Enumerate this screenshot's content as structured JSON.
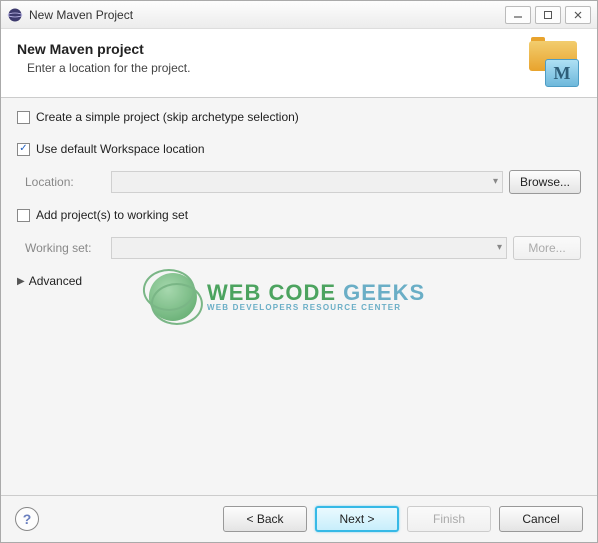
{
  "window": {
    "title": "New Maven Project"
  },
  "banner": {
    "heading": "New Maven project",
    "subtitle": "Enter a location for the project.",
    "icon_letter": "M"
  },
  "options": {
    "simple_project": {
      "checked": false,
      "label": "Create a simple project (skip archetype selection)"
    },
    "default_workspace": {
      "checked": true,
      "label": "Use default Workspace location"
    },
    "location": {
      "label": "Location:",
      "value": "",
      "browse_label": "Browse..."
    },
    "working_set": {
      "checked": false,
      "label": "Add project(s) to working set",
      "field_label": "Working set:",
      "value": "",
      "more_label": "More..."
    },
    "advanced_label": "Advanced"
  },
  "watermark": {
    "line1a": "WEB CODE ",
    "line1b": "GEEKS",
    "line2": "WEB DEVELOPERS RESOURCE CENTER"
  },
  "footer": {
    "help": "?",
    "back": "< Back",
    "next": "Next >",
    "finish": "Finish",
    "cancel": "Cancel"
  }
}
